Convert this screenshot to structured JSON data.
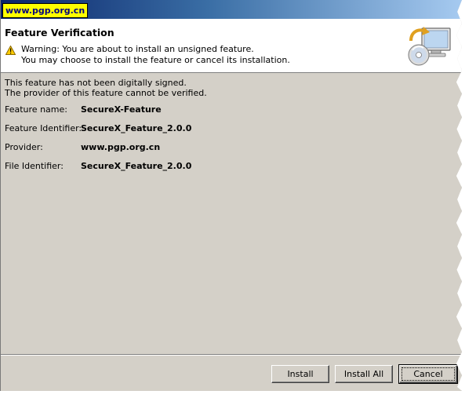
{
  "watermark": "www.pgp.org.cn",
  "banner": {
    "title": "Feature Verification",
    "warning_line1": "Warning: You are about to install an unsigned feature.",
    "warning_line2": "You may choose to install the feature or cancel its installation."
  },
  "body": {
    "note_line1": "This feature has not been digitally signed.",
    "note_line2": "The provider of this feature cannot be verified.",
    "fields": [
      {
        "label": "Feature name:",
        "value": "SecureX-Feature"
      },
      {
        "label": "Feature Identifier:",
        "value": "SecureX_Feature_2.0.0"
      },
      {
        "label": "Provider:",
        "value": "www.pgp.org.cn"
      },
      {
        "label": "File Identifier:",
        "value": "SecureX_Feature_2.0.0"
      }
    ]
  },
  "buttons": {
    "install": "Install",
    "install_all": "Install All",
    "cancel": "Cancel"
  },
  "icons": {
    "warning": "warning-icon",
    "banner": "install-monitor-cd-icon"
  },
  "colors": {
    "dialog_bg": "#d4d0c8",
    "watermark_bg": "#ffff00",
    "title_gradient_start": "#0a246a",
    "title_gradient_end": "#a6caf0"
  }
}
